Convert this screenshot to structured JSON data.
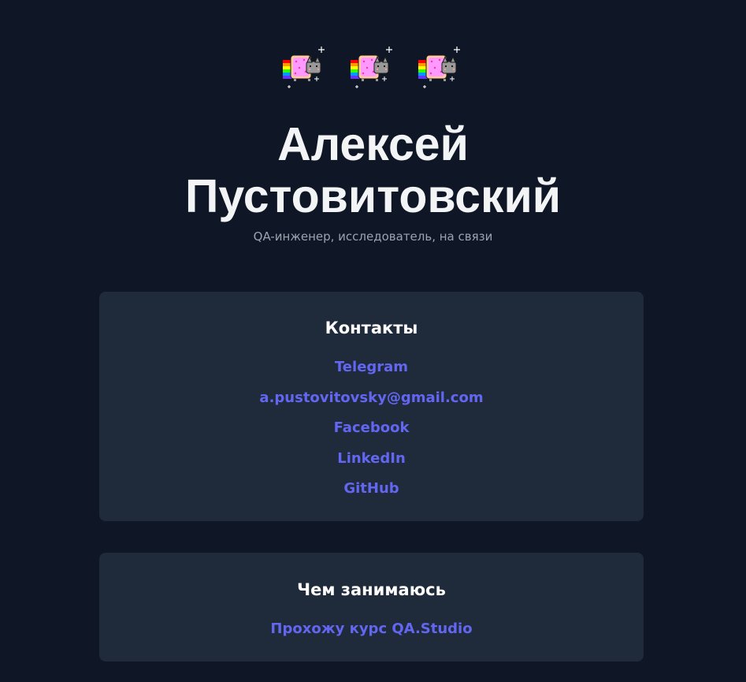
{
  "header": {
    "decorations": [
      "nyan-cat-icon",
      "nyan-cat-icon",
      "nyan-cat-icon"
    ],
    "name_line1": "Алексей",
    "name_line2": "Пустовитовский",
    "subtitle": "QA-инженер, исследователь, на связи"
  },
  "contacts": {
    "title": "Контакты",
    "links": [
      {
        "label": "Telegram"
      },
      {
        "label": "a.pustovitovsky@gmail.com"
      },
      {
        "label": "Facebook"
      },
      {
        "label": "LinkedIn"
      },
      {
        "label": "GitHub"
      }
    ]
  },
  "activity": {
    "title": "Чем занимаюсь",
    "links": [
      {
        "label": "Прохожу курс QA.Studio"
      }
    ]
  },
  "colors": {
    "background": "#0f1626",
    "card": "#1f2a3a",
    "link": "#6366f1",
    "title": "#f3f4f6",
    "muted": "#9ca3af"
  }
}
